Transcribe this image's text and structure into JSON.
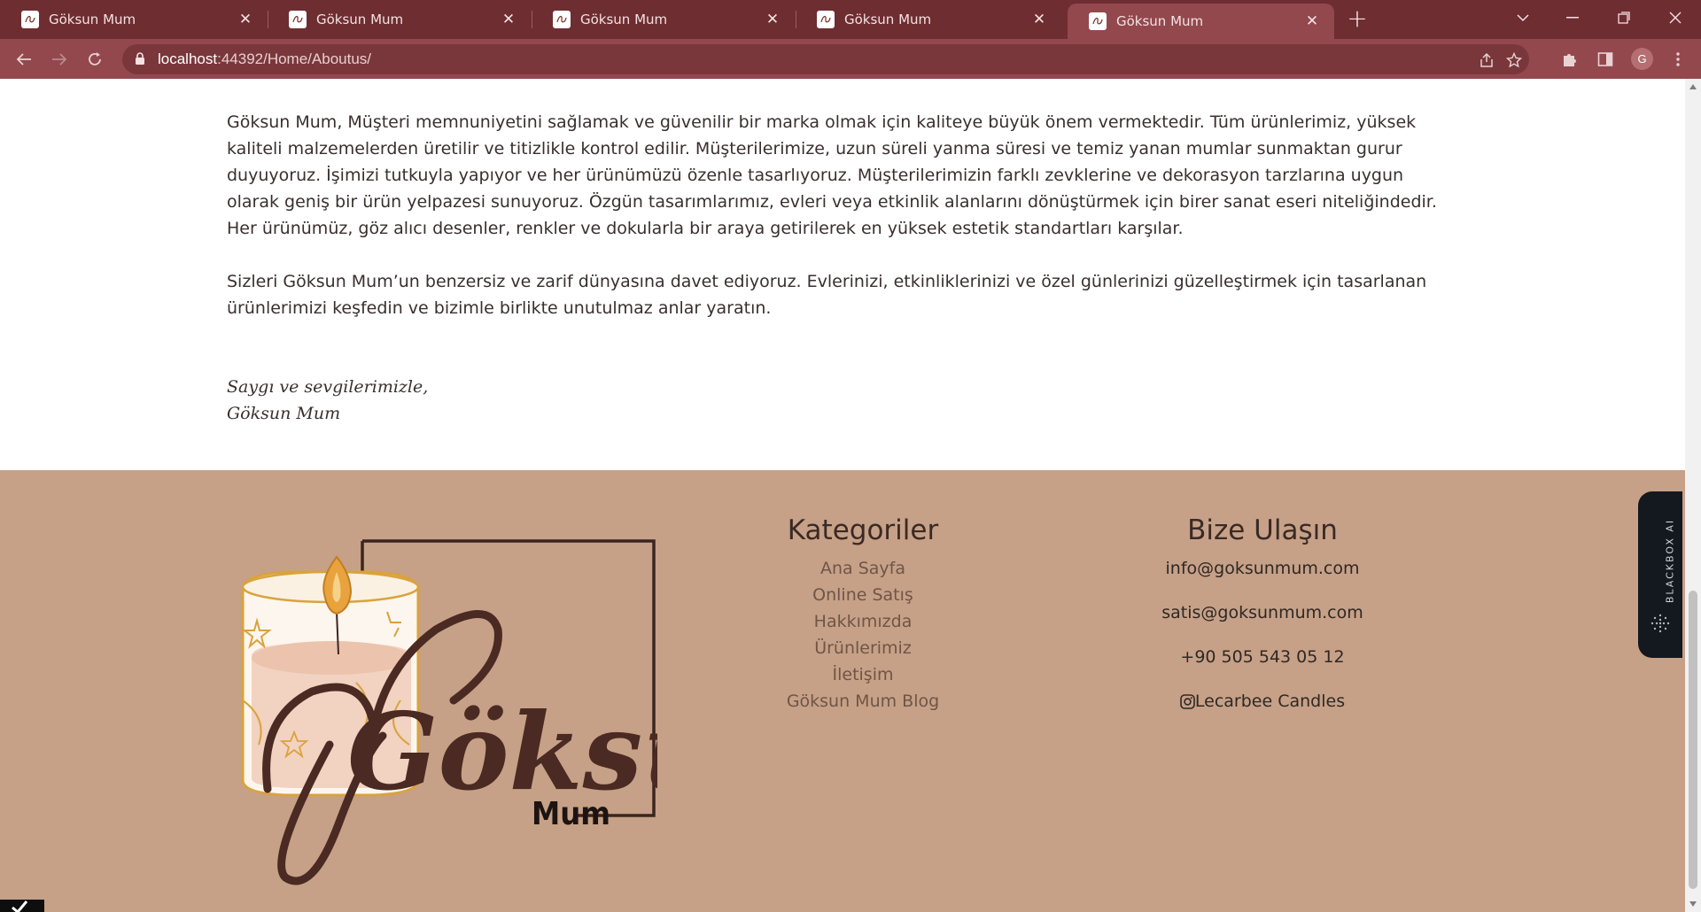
{
  "browser": {
    "tabs": [
      {
        "title": "Göksun Mum",
        "active": false
      },
      {
        "title": "Göksun Mum",
        "active": false
      },
      {
        "title": "Göksun Mum",
        "active": false
      },
      {
        "title": "Göksun Mum",
        "active": false
      },
      {
        "title": "Göksun Mum",
        "active": true
      }
    ],
    "url_host": "localhost",
    "url_path": ":44392/Home/Aboutus/",
    "profile_initial": "G"
  },
  "content": {
    "paragraph1": "Göksun Mum, Müşteri memnuniyetini sağlamak ve güvenilir bir marka olmak için kaliteye büyük önem vermektedir. Tüm ürünlerimiz, yüksek kaliteli malzemelerden üretilir ve titizlikle kontrol edilir. Müşterilerimize, uzun süreli yanma süresi ve temiz yanan mumlar sunmaktan gurur duyuyoruz. İşimizi tutkuyla yapıyor ve her ürünümüzü özenle tasarlıyoruz. Müşterilerimizin farklı zevklerine ve dekorasyon tarzlarına uygun olarak geniş bir ürün yelpazesi sunuyoruz. Özgün tasarımlarımız, evleri veya etkinlik alanlarını dönüştürmek için birer sanat eseri niteliğindedir. Her ürünümüz, göz alıcı desenler, renkler ve dokularla bir araya getirilerek en yüksek estetik standartları karşılar.",
    "paragraph2": "Sizleri Göksun Mum’un benzersiz ve zarif dünyasına davet ediyoruz. Evlerinizi, etkinliklerinizi ve özel günlerinizi güzelleştirmek için tasarlanan ürünlerimizi keşfedin ve bizimle birlikte unutulmaz anlar yaratın.",
    "signature_line1": "Saygı ve sevgilerimizle,",
    "signature_line2": "Göksun Mum"
  },
  "footer": {
    "logo_text": "Göksun",
    "logo_subtext": "Mum",
    "categories_title": "Kategoriler",
    "categories": [
      "Ana Sayfa",
      "Online Satış",
      "Hakkımızda",
      "Ürünlerimiz",
      "İletişim",
      "Göksun Mum Blog"
    ],
    "contact_title": "Bize Ulaşın",
    "email_info": "info@goksunmum.com",
    "email_sales": "satis@goksunmum.com",
    "phone": "+90 505 543 05 12",
    "instagram": "Lecarbee Candles"
  },
  "widget": {
    "label": "BLACKBOX AI"
  },
  "colors": {
    "tabbar": "#6e2d31",
    "toolbar": "#93484d",
    "footer": "#c6a187",
    "logo_brown": "#4a2a22"
  }
}
